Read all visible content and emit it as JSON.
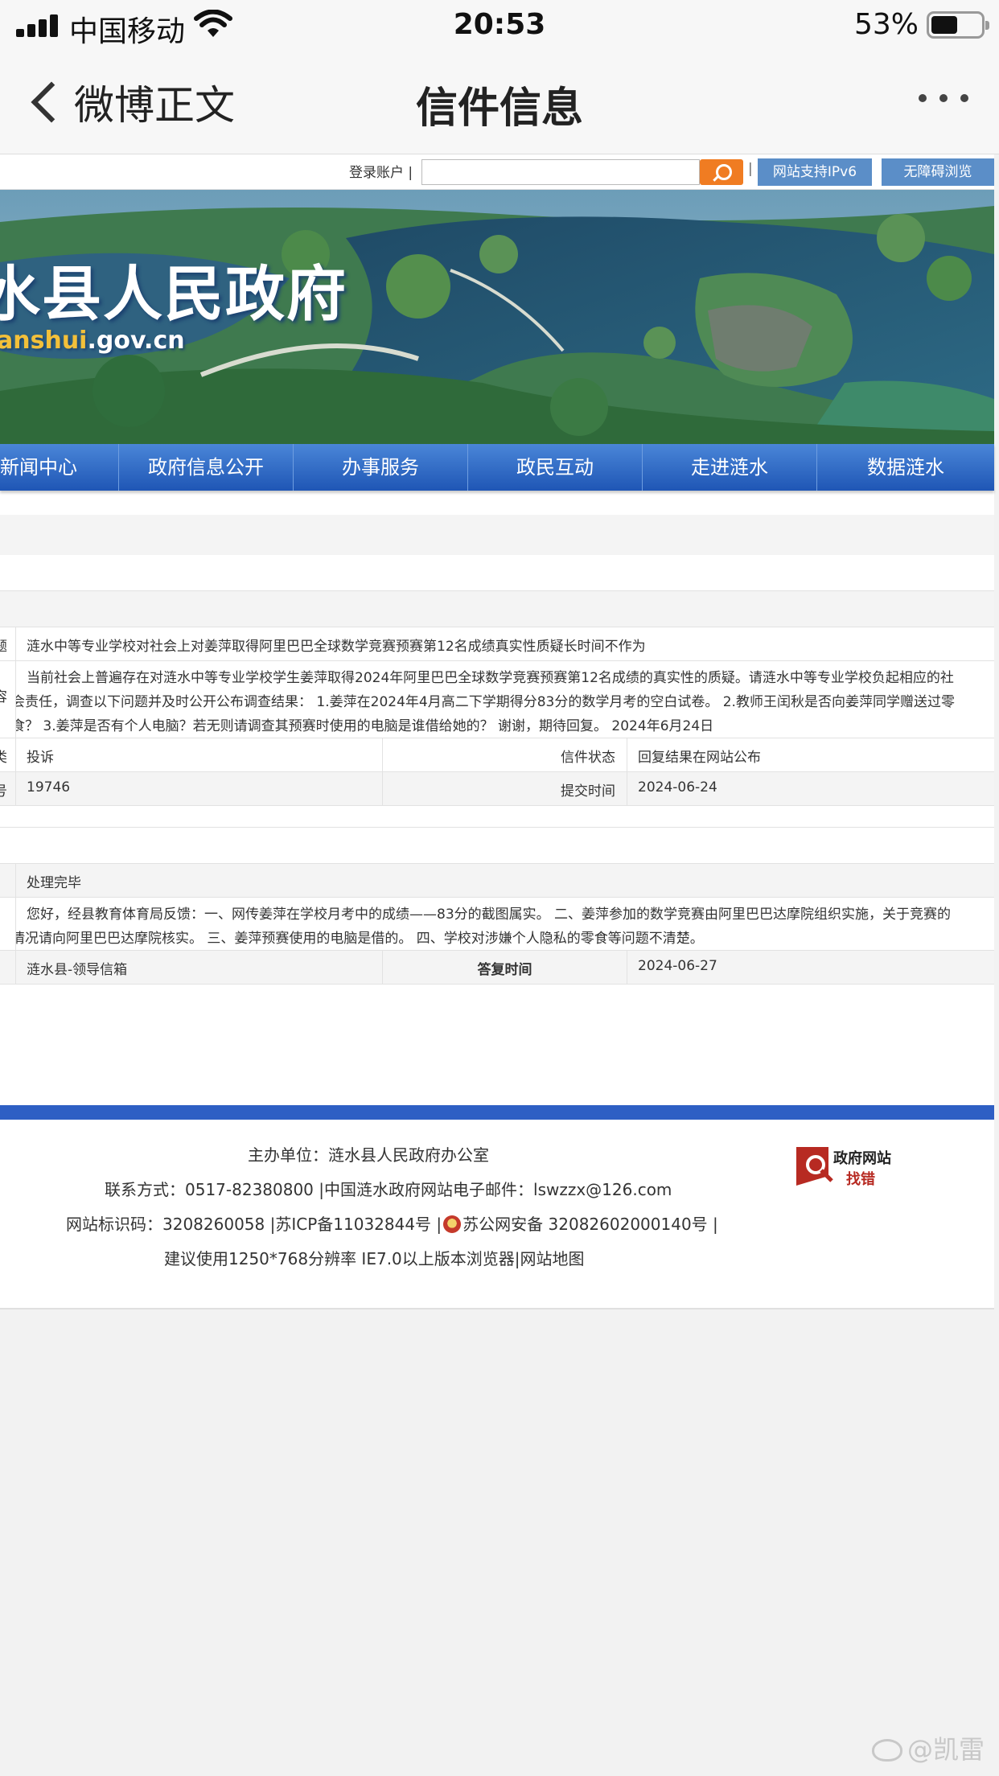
{
  "status_bar": {
    "carrier": "中国移动",
    "time": "20:53",
    "battery": "53%",
    "battery_level": 0.53
  },
  "nav": {
    "back_label": "微博正文",
    "title": "信件信息"
  },
  "site": {
    "top": {
      "login_label": "登录账户 |",
      "divider": "|",
      "ipv6_label": "网站支持IPv6",
      "accessibility_label": "无障碍浏览"
    },
    "banner": {
      "title_visible": "水县人民政府",
      "url_prefix": "anshui",
      "url_suffix": ".gov.cn"
    },
    "main_nav": [
      "新闻中心",
      "政府信息公开",
      "办事服务",
      "政民互动",
      "走进涟水",
      "数据涟水"
    ]
  },
  "letter": {
    "title_label_cut": "题",
    "title": "涟水中等专业学校对社会上对姜萍取得阿里巴巴全球数学竞赛预赛第12名成绩真实性质疑长时间不作为",
    "content_label_cut": "容",
    "content_line1": "当前社会上普遍存在对涟水中等专业学校学生姜萍取得2024年阿里巴巴全球数学竞赛预赛第12名成绩的真实性的质疑。请涟水中等专业学校负起相应的社",
    "content_line2": "会责任，调查以下问题并及时公开公布调查结果： 1.姜萍在2024年4月高二下学期得分83分的数学月考的空白试卷。 2.教师王闰秋是否向姜萍同学赠送过零",
    "content_line3": "食？ 3.姜萍是否有个人电脑？若无则请调查其预赛时使用的电脑是谁借给她的？ 谢谢，期待回复。 2024年6月24日",
    "type_label_cut": "类",
    "type": "投诉",
    "status_label": "信件状态",
    "status": "回复结果在网站公布",
    "number_label_cut": "号",
    "number": "19746",
    "submit_label": "提交时间",
    "submit_time": "2024-06-24"
  },
  "reply": {
    "status": "处理完毕",
    "content_line1": "您好，经县教育体育局反馈：一、网传姜萍在学校月考中的成绩——83分的截图属实。 二、姜萍参加的数学竞赛由阿里巴巴达摩院组织实施，关于竞赛的",
    "content_line2": "情况请向阿里巴巴达摩院核实。 三、姜萍预赛使用的电脑是借的。 四、学校对涉嫌个人隐私的零食等问题不清楚。",
    "unit": "涟水县-领导信箱",
    "reply_time_label": "答复时间",
    "reply_time": "2024-06-27"
  },
  "footer": {
    "host": "主办单位：涟水县人民政府办公室",
    "contact": "联系方式：0517-82380800 |中国涟水政府网站电子邮件：lswzzx@126.com",
    "id_prefix": "网站标识码：3208260058 |苏ICP备11032844号 |",
    "id_police": "苏公网安备 32082602000140号 |",
    "browser": "建议使用1250*768分辨率 IE7.0以上版本浏览器|网站地图",
    "badge_line1": "政府网站",
    "badge_line2": "找错"
  },
  "watermark": "@凯雷",
  "colors": {
    "nav_blue": "#2e5fc4",
    "search_orange": "#f07c22",
    "button_blue": "#5b8ec8",
    "badge_red": "#b72a22"
  }
}
